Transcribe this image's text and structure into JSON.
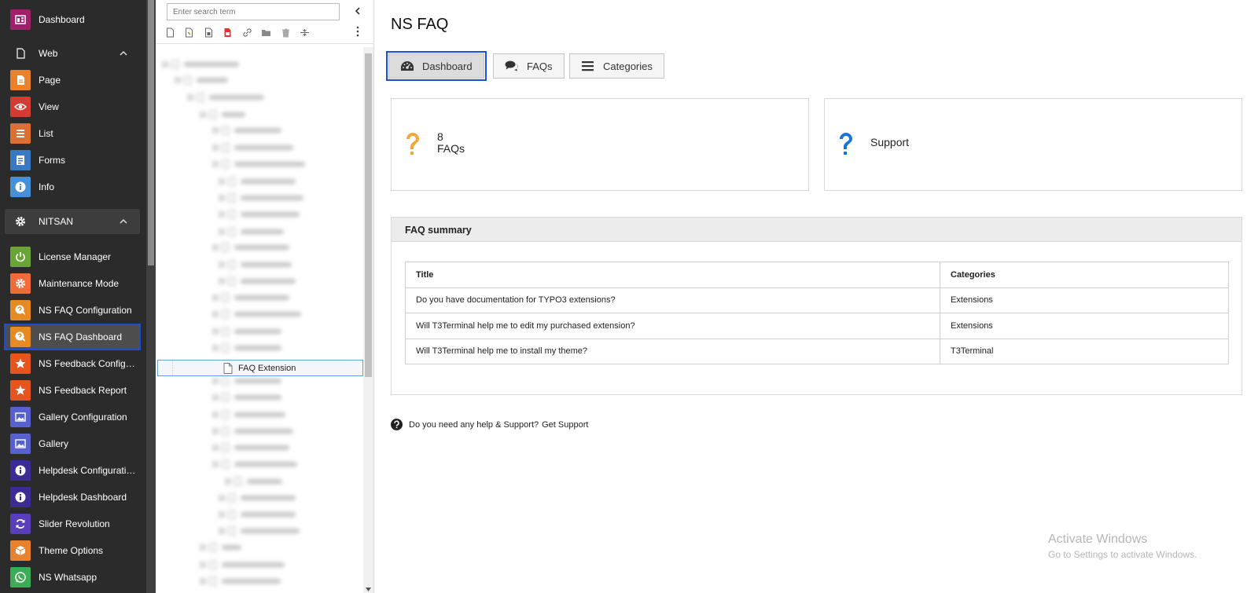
{
  "module_menu": {
    "items": [
      {
        "label": "Dashboard",
        "icon": "dashboard-icon",
        "color": "#a0206b"
      },
      {
        "label": "Web",
        "icon": "page-outline-icon",
        "group": true
      },
      {
        "label": "Page",
        "icon": "page-icon",
        "color": "#e8822e"
      },
      {
        "label": "View",
        "icon": "eye-icon",
        "color": "#d33c32"
      },
      {
        "label": "List",
        "icon": "list-icon",
        "color": "#de6e31"
      },
      {
        "label": "Forms",
        "icon": "form-icon",
        "color": "#3a7ac5"
      },
      {
        "label": "Info",
        "icon": "info-icon",
        "color": "#4590d6"
      },
      {
        "label": "NITSAN",
        "icon": "gear-icon",
        "group": true
      },
      {
        "label": "License Manager",
        "icon": "power-icon",
        "color": "#6aa535"
      },
      {
        "label": "Maintenance Mode",
        "icon": "gear-icon",
        "color": "#f06a3b"
      },
      {
        "label": "NS FAQ Configuration",
        "icon": "faq-icon",
        "color": "#e68a24"
      },
      {
        "label": "NS FAQ Dashboard",
        "icon": "faq-icon",
        "color": "#e68a24",
        "active": true
      },
      {
        "label": "NS Feedback Configur...",
        "icon": "star-icon",
        "color": "#e65520"
      },
      {
        "label": "NS Feedback Report",
        "icon": "star-icon",
        "color": "#e65520"
      },
      {
        "label": "Gallery Configuration",
        "icon": "image-icon",
        "color": "#5860cf"
      },
      {
        "label": "Gallery",
        "icon": "image-icon",
        "color": "#5860cf"
      },
      {
        "label": "Helpdesk Configuration",
        "icon": "info-icon",
        "color": "#3a2c94"
      },
      {
        "label": "Helpdesk Dashboard",
        "icon": "info-icon",
        "color": "#3a2c94"
      },
      {
        "label": "Slider Revolution",
        "icon": "refresh-icon",
        "color": "#5a3dbb"
      },
      {
        "label": "Theme Options",
        "icon": "box-icon",
        "color": "#e8822e"
      },
      {
        "label": "NS Whatsapp",
        "icon": "whatsapp-icon",
        "color": "#3bae55"
      }
    ]
  },
  "tree": {
    "search_placeholder": "Enter search term",
    "selected_label": "FAQ Extension"
  },
  "main": {
    "title": "NS FAQ",
    "tabs": [
      {
        "label": "Dashboard",
        "icon": "dashboard-gauge-icon",
        "active": true
      },
      {
        "label": "FAQs",
        "icon": "comments-icon"
      },
      {
        "label": "Categories",
        "icon": "bars-icon"
      }
    ],
    "faq_card": {
      "count": "8",
      "label": "FAQs"
    },
    "support_card": {
      "label": "Support"
    },
    "summary": {
      "title": "FAQ summary",
      "columns": [
        "Title",
        "Categories"
      ],
      "rows": [
        [
          "Do you have documentation for TYPO3 extensions?",
          "Extensions"
        ],
        [
          "Will T3Terminal help me to edit my purchased extension?",
          "Extensions"
        ],
        [
          "Will T3Terminal help me to install my theme?",
          "T3Terminal"
        ]
      ]
    },
    "help": {
      "text": "Do you need any help & Support?",
      "link": "Get Support"
    }
  },
  "watermark": {
    "line1": "Activate Windows",
    "line2": "Go to Settings to activate Windows."
  }
}
